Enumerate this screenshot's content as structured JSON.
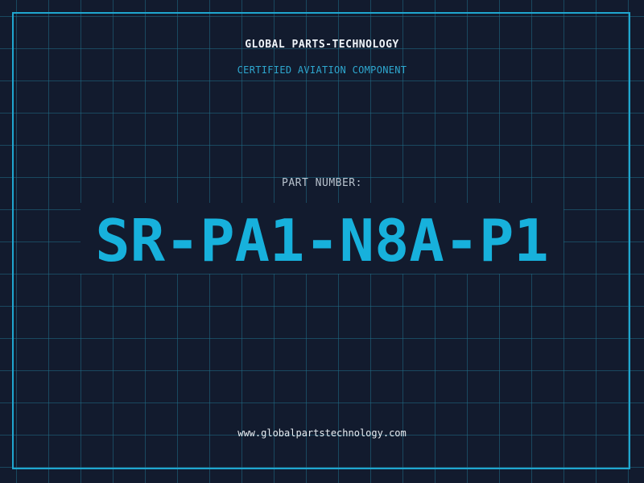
{
  "header": {
    "company": "GLOBAL PARTS-TECHNOLOGY",
    "subtitle": "CERTIFIED AVIATION COMPONENT"
  },
  "part": {
    "label": "PART NUMBER:",
    "number": "SR-PA1-N8A-P1"
  },
  "footer": {
    "website": "www.globalpartstechnology.com"
  },
  "colors": {
    "background": "#121b2e",
    "grid": "#1d4f66",
    "accent": "#17b1dc",
    "frame": "#1fa6cf"
  }
}
